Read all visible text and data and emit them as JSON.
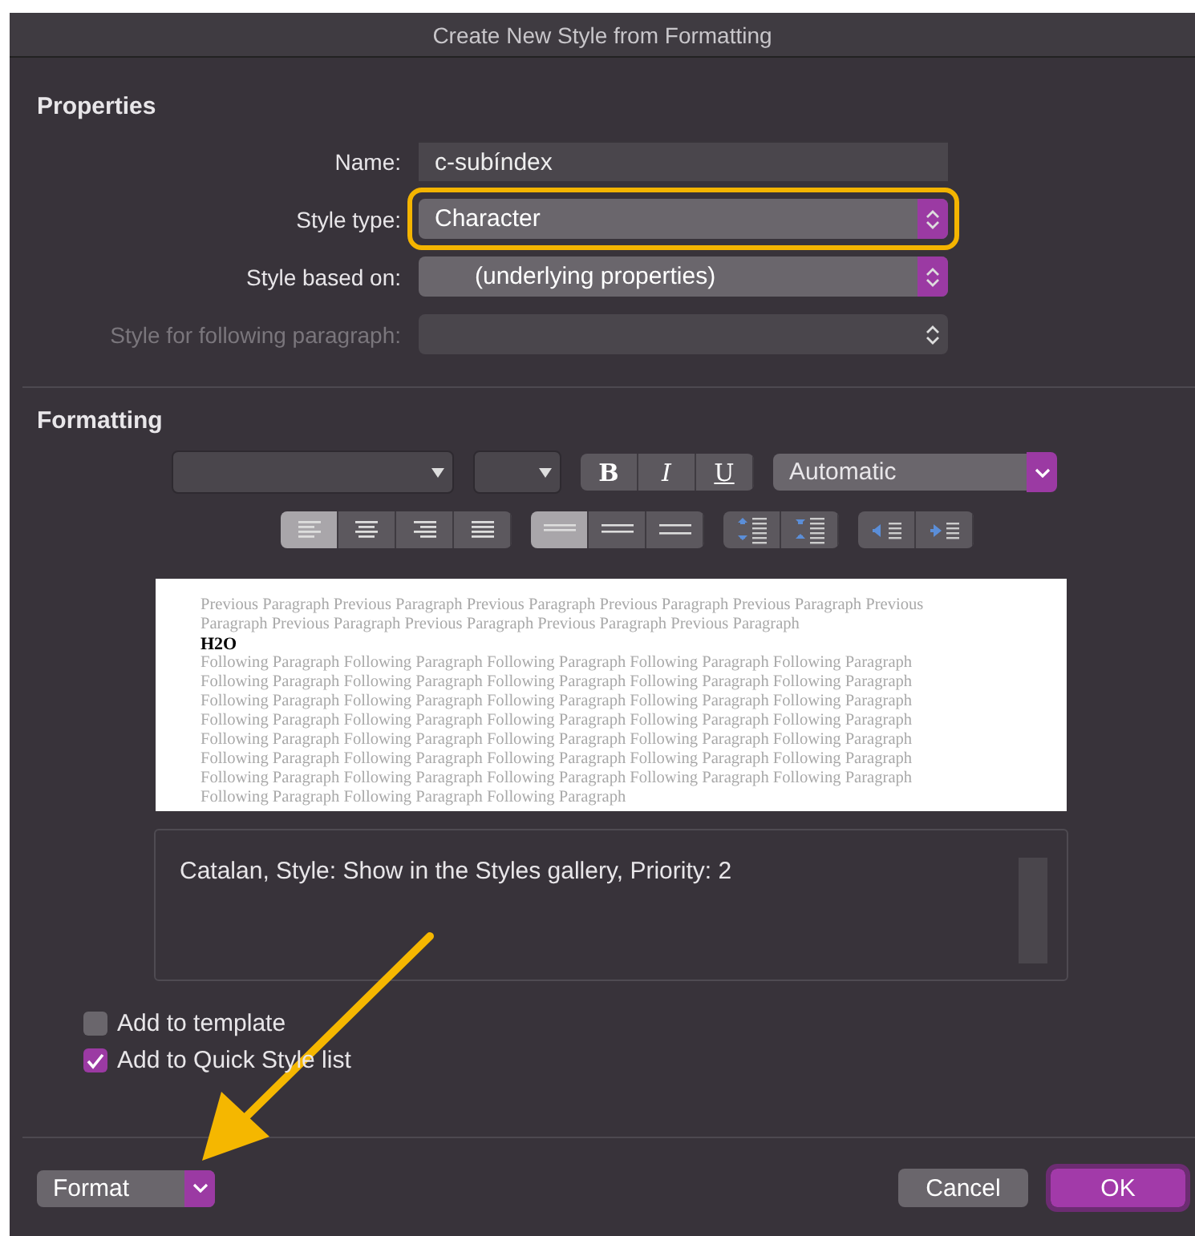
{
  "window": {
    "title": "Create New Style from Formatting"
  },
  "properties": {
    "heading": "Properties",
    "fields": [
      {
        "kind": "text",
        "label": "Name:",
        "value": "c-subíndex",
        "disabled": false
      },
      {
        "kind": "select",
        "label": "Style type:",
        "value": "Character",
        "disabled": false,
        "highlighted": true
      },
      {
        "kind": "select",
        "label": "Style based on:",
        "value": "      (underlying properties)",
        "disabled": false
      },
      {
        "kind": "select",
        "label": "Style for following paragraph:",
        "disabled": true
      }
    ]
  },
  "formatting": {
    "heading": "Formatting",
    "font_styles": [
      {
        "label": "B",
        "kind": "bold"
      },
      {
        "label": "I",
        "kind": "italic"
      },
      {
        "label": "U",
        "kind": "underline"
      }
    ],
    "font_color": "Automatic",
    "alignment": [
      {
        "kind": "left",
        "selected": true
      },
      {
        "kind": "center",
        "selected": false
      },
      {
        "kind": "right",
        "selected": false
      },
      {
        "kind": "justify",
        "selected": false
      }
    ],
    "line_spacing": [
      {
        "kind": "single",
        "selected": true
      },
      {
        "kind": "onehalf",
        "selected": false
      },
      {
        "kind": "double",
        "selected": false
      }
    ],
    "paragraph_spacing": [
      {
        "kind": "up"
      },
      {
        "kind": "down"
      }
    ],
    "indent": [
      {
        "kind": "decrease"
      },
      {
        "kind": "increase"
      }
    ]
  },
  "preview": {
    "previous": "Previous Paragraph Previous Paragraph Previous Paragraph Previous Paragraph Previous Paragraph Previous Paragraph Previous Paragraph Previous Paragraph Previous Paragraph Previous Paragraph",
    "sample": "H2O",
    "following": "Following Paragraph Following Paragraph Following Paragraph Following Paragraph Following Paragraph Following Paragraph Following Paragraph Following Paragraph Following Paragraph Following Paragraph Following Paragraph Following Paragraph Following Paragraph Following Paragraph Following Paragraph Following Paragraph Following Paragraph Following Paragraph Following Paragraph Following Paragraph Following Paragraph Following Paragraph Following Paragraph Following Paragraph Following Paragraph Following Paragraph Following Paragraph Following Paragraph Following Paragraph Following Paragraph Following Paragraph Following Paragraph Following Paragraph Following Paragraph Following Paragraph Following Paragraph Following Paragraph Following Paragraph"
  },
  "description": "Catalan, Style: Show in the Styles gallery, Priority: 2",
  "options": [
    {
      "label": "Add to template",
      "checked": false
    },
    {
      "label": "Add to Quick Style list",
      "checked": true
    }
  ],
  "footer": {
    "format": "Format",
    "cancel": "Cancel",
    "ok": "OK"
  }
}
